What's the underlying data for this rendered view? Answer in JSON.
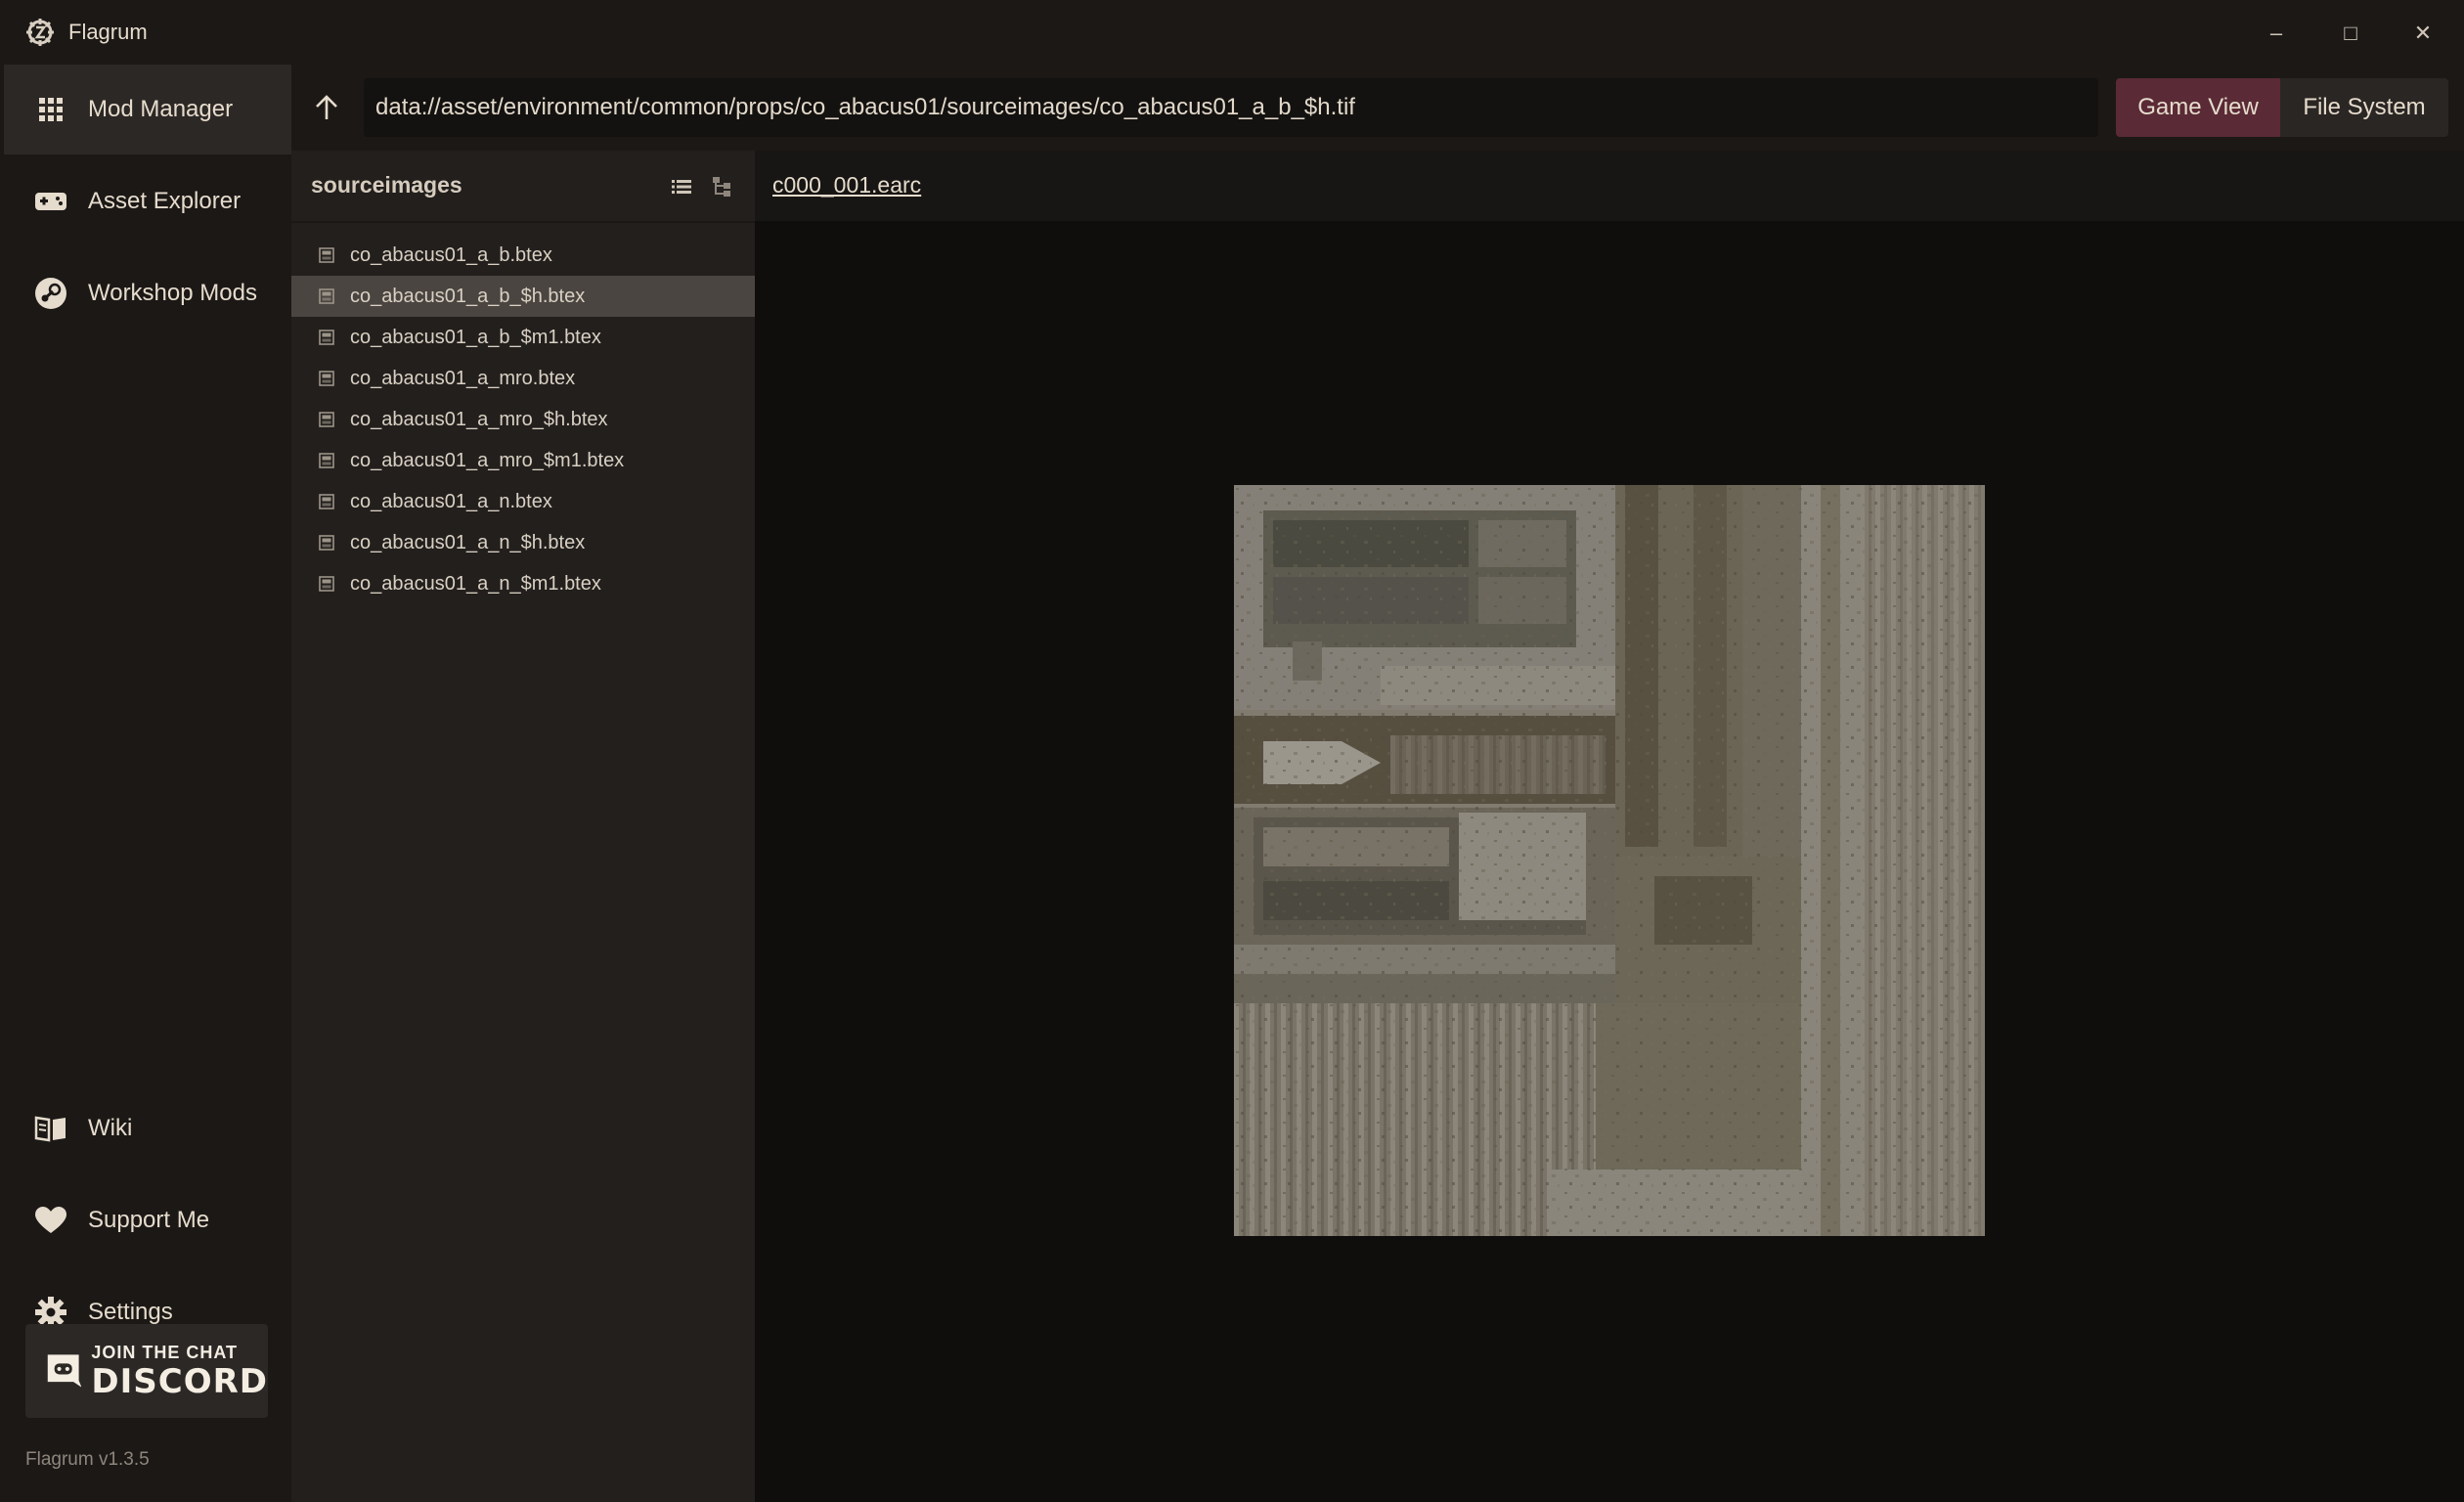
{
  "titlebar": {
    "title": "Flagrum",
    "minimize": "–",
    "maximize": "□",
    "close": "✕"
  },
  "sidebar": {
    "items": [
      {
        "label": "Mod Manager",
        "icon": "grid-icon",
        "active": true
      },
      {
        "label": "Asset Explorer",
        "icon": "gamepad-icon",
        "active": false
      },
      {
        "label": "Workshop Mods",
        "icon": "steam-icon",
        "active": false
      },
      {
        "label": "Wiki",
        "icon": "book-icon",
        "active": false
      },
      {
        "label": "Support Me",
        "icon": "heart-icon",
        "active": false
      },
      {
        "label": "Settings",
        "icon": "gear-icon",
        "active": false
      }
    ],
    "discord": {
      "join": "JOIN THE CHAT",
      "word": "DISCORD"
    },
    "version": "Flagrum v1.3.5"
  },
  "toolbar": {
    "path": "data://asset/environment/common/props/co_abacus01/sourceimages/co_abacus01_a_b_$h.tif",
    "view_buttons": {
      "game_view": "Game View",
      "file_system": "File System"
    }
  },
  "file_panel": {
    "title": "sourceimages",
    "files": [
      "co_abacus01_a_b.btex",
      "co_abacus01_a_b_$h.btex",
      "co_abacus01_a_b_$m1.btex",
      "co_abacus01_a_mro.btex",
      "co_abacus01_a_mro_$h.btex",
      "co_abacus01_a_mro_$m1.btex",
      "co_abacus01_a_n.btex",
      "co_abacus01_a_n_$h.btex",
      "co_abacus01_a_n_$m1.btex"
    ],
    "selected_index": 1
  },
  "preview": {
    "archive": "c000_001.earc"
  },
  "colors": {
    "accent": "#5a2a36",
    "background": "#1b1816",
    "panel": "#221f1d",
    "viewer": "#0f0e0d",
    "selected_row": "#4a4541"
  }
}
